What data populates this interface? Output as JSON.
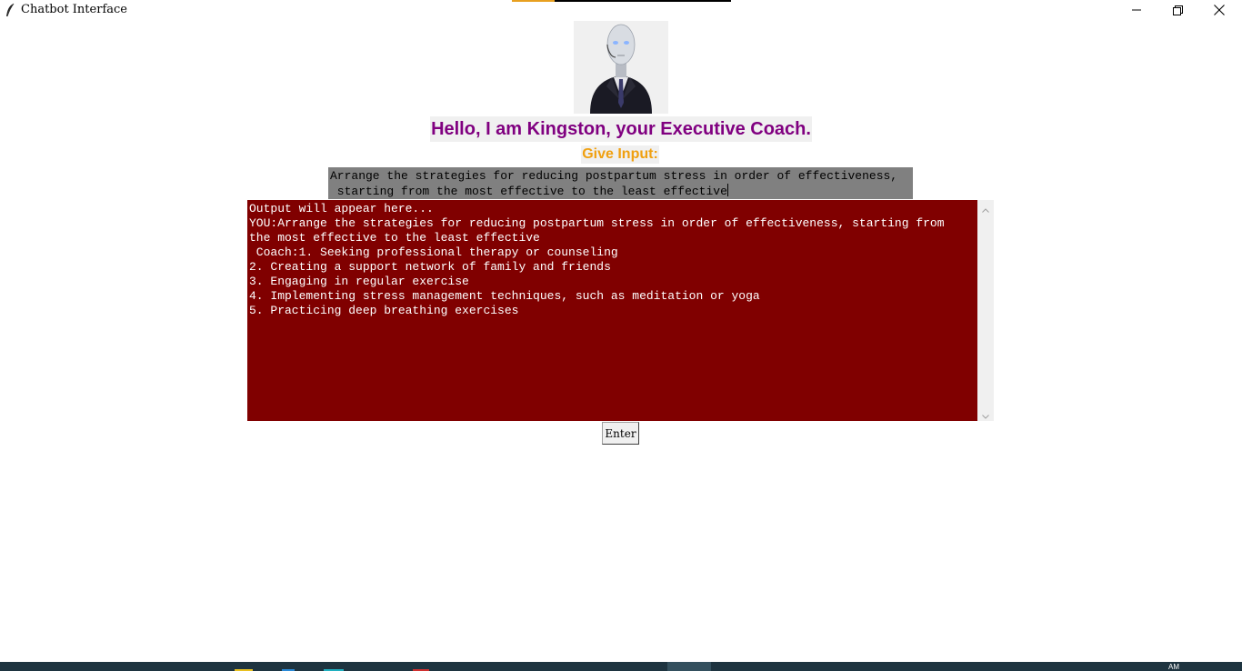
{
  "window": {
    "title": "Chatbot Interface"
  },
  "header": {
    "greeting": "Hello, I am Kingston, your Executive Coach.",
    "input_label": "Give Input:"
  },
  "input": {
    "value": "Arrange the strategies for reducing postpartum stress in order of effectiveness,\n starting from the most effective to the least effective"
  },
  "output": {
    "text": "Output will appear here...\nYOU:Arrange the strategies for reducing postpartum stress in order of effectiveness, starting from\nthe most effective to the least effective\n Coach:1. Seeking professional therapy or counseling\n2. Creating a support network of family and friends\n3. Engaging in regular exercise\n4. Implementing stress management techniques, such as meditation or yoga\n5. Practicing deep breathing exercises"
  },
  "buttons": {
    "enter_label": "Enter"
  },
  "taskbar": {
    "clock": "AM"
  },
  "colors": {
    "greeting": "#800080",
    "input_label": "#f0a010",
    "input_bg": "#808080",
    "output_bg": "#800000",
    "output_text": "#ffffff"
  }
}
